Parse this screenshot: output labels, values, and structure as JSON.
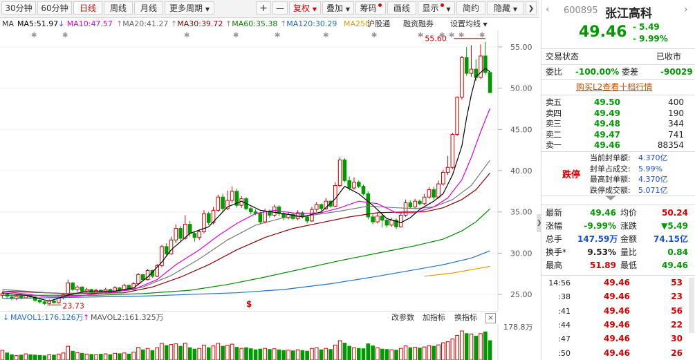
{
  "toolbar": {
    "periods": [
      "30分钟",
      "60分钟",
      "日线",
      "周线",
      "月线",
      "更多周期"
    ],
    "plus": "+",
    "minus": "—",
    "fuquan": "复权",
    "overlay": "叠加",
    "chips": "筹码",
    "draw": "画线",
    "display": "显示",
    "simple": "简约",
    "hide": "隐藏"
  },
  "ma_legend": {
    "ma": "MA",
    "ma5": "MA5:51.97",
    "ma10": "MA10:47.57",
    "ma20": "MA20:41.27",
    "ma30": "MA30:39.72",
    "ma60": "MA60:35.38",
    "ma120": "MA120:30.29",
    "ma250": "MA250",
    "hugutong": "沪股通",
    "margin": "融资融券",
    "settings": "设置均线"
  },
  "colors": {
    "ma5": "#000000",
    "ma10": "#e000e0",
    "ma20": "#777777",
    "ma30": "#8b0000",
    "ma60": "#008800",
    "ma120": "#1e6fd0",
    "ma250": "#e0a000",
    "up": "#d40000",
    "down": "#009900"
  },
  "chart_data": {
    "type": "candlestick",
    "y_ticks": [
      "55.00",
      "50.00",
      "45.00",
      "40.00",
      "35.00",
      "30.00",
      "25.00"
    ],
    "ylim": [
      23.0,
      57.0
    ],
    "high_annotation": "55.60",
    "low_annotation": "23.73",
    "candles": [
      [
        24.9,
        25.1,
        24.6,
        25.3
      ],
      [
        25.0,
        24.8,
        24.5,
        25.2
      ],
      [
        24.7,
        24.5,
        24.3,
        24.9
      ],
      [
        24.5,
        24.8,
        24.3,
        25.0
      ],
      [
        24.8,
        24.6,
        24.4,
        24.9
      ],
      [
        24.6,
        24.9,
        24.5,
        25.1
      ],
      [
        24.9,
        24.7,
        24.5,
        25.0
      ],
      [
        24.7,
        24.3,
        24.1,
        24.8
      ],
      [
        24.3,
        24.1,
        23.9,
        24.4
      ],
      [
        24.1,
        23.9,
        23.73,
        24.2
      ],
      [
        23.9,
        24.2,
        23.8,
        24.4
      ],
      [
        24.2,
        24.0,
        23.9,
        24.3
      ],
      [
        24.0,
        24.6,
        23.9,
        24.8
      ],
      [
        24.6,
        25.0,
        24.4,
        25.2
      ],
      [
        25.0,
        26.4,
        24.8,
        26.8
      ],
      [
        26.4,
        25.6,
        25.4,
        26.5
      ],
      [
        25.6,
        25.9,
        25.3,
        26.1
      ],
      [
        25.9,
        25.4,
        25.2,
        26.0
      ],
      [
        25.4,
        25.6,
        25.2,
        25.8
      ],
      [
        25.6,
        25.2,
        25.0,
        25.7
      ],
      [
        25.2,
        25.5,
        25.0,
        25.7
      ],
      [
        25.5,
        25.3,
        25.1,
        25.6
      ],
      [
        25.3,
        25.6,
        25.1,
        25.8
      ],
      [
        25.6,
        25.4,
        25.2,
        25.7
      ],
      [
        25.4,
        25.8,
        25.3,
        26.0
      ],
      [
        25.8,
        25.5,
        25.3,
        25.9
      ],
      [
        25.5,
        26.1,
        25.4,
        26.3
      ],
      [
        26.1,
        25.6,
        25.5,
        26.2
      ],
      [
        25.6,
        26.3,
        25.5,
        26.5
      ],
      [
        26.3,
        27.4,
        26.1,
        27.6
      ],
      [
        27.4,
        26.8,
        26.6,
        27.5
      ],
      [
        26.8,
        27.9,
        26.7,
        28.1
      ],
      [
        27.9,
        27.2,
        27.0,
        28.0
      ],
      [
        27.2,
        28.5,
        27.1,
        28.7
      ],
      [
        28.5,
        30.8,
        28.3,
        31.0
      ],
      [
        30.8,
        29.9,
        29.6,
        31.2
      ],
      [
        29.9,
        31.6,
        29.8,
        32.0
      ],
      [
        31.6,
        33.0,
        31.2,
        33.5
      ],
      [
        33.0,
        31.8,
        31.5,
        33.3
      ],
      [
        31.8,
        33.5,
        31.6,
        34.6
      ],
      [
        33.5,
        32.4,
        32.0,
        33.9
      ],
      [
        32.4,
        31.9,
        31.4,
        32.6
      ],
      [
        31.9,
        32.6,
        31.6,
        32.9
      ],
      [
        32.6,
        34.8,
        32.4,
        35.2
      ],
      [
        34.8,
        33.7,
        33.4,
        35.0
      ],
      [
        33.7,
        35.2,
        33.5,
        35.6
      ],
      [
        35.2,
        36.8,
        35.0,
        37.1
      ],
      [
        36.8,
        35.4,
        35.1,
        37.2
      ],
      [
        35.4,
        36.4,
        35.2,
        37.6
      ],
      [
        36.4,
        37.5,
        36.1,
        38.1
      ],
      [
        37.5,
        35.8,
        35.5,
        37.8
      ],
      [
        35.8,
        36.6,
        35.5,
        36.9
      ],
      [
        36.6,
        35.4,
        35.2,
        36.8
      ],
      [
        35.4,
        35.0,
        34.7,
        35.6
      ],
      [
        35.0,
        34.8,
        34.6,
        35.3
      ],
      [
        34.8,
        33.8,
        33.5,
        35.0
      ],
      [
        33.8,
        35.1,
        33.6,
        35.4
      ],
      [
        35.1,
        34.6,
        34.3,
        35.3
      ],
      [
        34.6,
        35.6,
        34.4,
        35.9
      ],
      [
        35.6,
        34.8,
        34.5,
        35.8
      ],
      [
        34.8,
        34.3,
        34.0,
        35.0
      ],
      [
        34.3,
        34.7,
        34.1,
        35.0
      ],
      [
        34.7,
        34.2,
        34.0,
        34.9
      ],
      [
        34.2,
        34.9,
        34.0,
        35.2
      ],
      [
        34.9,
        34.4,
        34.2,
        35.1
      ],
      [
        34.4,
        33.9,
        33.6,
        34.6
      ],
      [
        33.9,
        35.3,
        33.8,
        35.6
      ],
      [
        35.3,
        35.9,
        35.0,
        36.2
      ],
      [
        35.9,
        35.4,
        35.1,
        36.0
      ],
      [
        35.4,
        36.3,
        35.2,
        36.7
      ],
      [
        36.3,
        35.7,
        35.5,
        36.4
      ],
      [
        35.7,
        38.2,
        35.6,
        38.6
      ],
      [
        38.2,
        41.3,
        38.0,
        41.6
      ],
      [
        41.3,
        38.8,
        38.6,
        41.5
      ],
      [
        38.8,
        37.9,
        37.6,
        39.3
      ],
      [
        37.9,
        38.6,
        37.7,
        39.2
      ],
      [
        38.6,
        38.1,
        37.9,
        38.8
      ],
      [
        38.1,
        37.2,
        37.0,
        38.3
      ],
      [
        37.2,
        34.4,
        34.1,
        37.5
      ],
      [
        34.4,
        33.8,
        33.5,
        34.8
      ],
      [
        33.8,
        34.5,
        33.6,
        34.9
      ],
      [
        34.5,
        34.0,
        33.1,
        34.7
      ],
      [
        34.0,
        33.4,
        33.1,
        34.2
      ],
      [
        33.4,
        34.0,
        33.2,
        34.3
      ],
      [
        34.0,
        33.2,
        32.9,
        34.2
      ],
      [
        33.2,
        34.6,
        33.1,
        35.0
      ],
      [
        34.6,
        36.1,
        34.4,
        36.5
      ],
      [
        36.1,
        35.6,
        35.4,
        36.4
      ],
      [
        35.6,
        36.3,
        35.4,
        36.6
      ],
      [
        36.3,
        36.0,
        35.8,
        36.5
      ],
      [
        36.0,
        36.8,
        35.8,
        37.2
      ],
      [
        36.8,
        37.7,
        36.6,
        38.0
      ],
      [
        37.7,
        36.8,
        36.5,
        38.1
      ],
      [
        36.8,
        38.4,
        36.6,
        38.8
      ],
      [
        38.4,
        39.8,
        38.2,
        40.1
      ],
      [
        39.8,
        40.4,
        39.5,
        41.8
      ],
      [
        40.4,
        44.4,
        40.2,
        44.6
      ],
      [
        44.4,
        48.9,
        44.2,
        49.0
      ],
      [
        48.9,
        53.7,
        48.6,
        53.9
      ],
      [
        53.7,
        51.8,
        51.5,
        55.0
      ],
      [
        51.8,
        52.3,
        51.4,
        55.2
      ],
      [
        52.3,
        51.3,
        50.9,
        53.5
      ],
      [
        51.3,
        53.9,
        51.1,
        55.3
      ],
      [
        53.9,
        51.9,
        51.6,
        55.6
      ],
      [
        51.9,
        49.46,
        49.46,
        51.89
      ]
    ],
    "ma5": [
      [
        0,
        25.2
      ],
      [
        5,
        24.9
      ],
      [
        10,
        24.2
      ],
      [
        14,
        24.9
      ],
      [
        18,
        25.4
      ],
      [
        24,
        25.4
      ],
      [
        28,
        25.8
      ],
      [
        31,
        27.1
      ],
      [
        34,
        28.9
      ],
      [
        36,
        30.4
      ],
      [
        40,
        32.4
      ],
      [
        44,
        33.2
      ],
      [
        48,
        35.6
      ],
      [
        51,
        36.3
      ],
      [
        55,
        35.2
      ],
      [
        60,
        34.8
      ],
      [
        64,
        34.4
      ],
      [
        68,
        35.0
      ],
      [
        71,
        36.6
      ],
      [
        73,
        38.1
      ],
      [
        76,
        37.2
      ],
      [
        79,
        35.8
      ],
      [
        82,
        34.2
      ],
      [
        85,
        33.7
      ],
      [
        87,
        34.3
      ],
      [
        89,
        35.3
      ],
      [
        92,
        36.3
      ],
      [
        94,
        37.2
      ],
      [
        96,
        39.5
      ],
      [
        98,
        43.0
      ],
      [
        99,
        46.4
      ],
      [
        100,
        49.2
      ],
      [
        101,
        51.4
      ],
      [
        103,
        52.4
      ],
      [
        104,
        51.97
      ]
    ],
    "ma10": [
      [
        0,
        25.4
      ],
      [
        10,
        24.7
      ],
      [
        16,
        24.8
      ],
      [
        22,
        25.2
      ],
      [
        28,
        25.6
      ],
      [
        33,
        26.8
      ],
      [
        37,
        28.6
      ],
      [
        42,
        30.4
      ],
      [
        46,
        32.1
      ],
      [
        50,
        33.6
      ],
      [
        54,
        34.8
      ],
      [
        58,
        35.2
      ],
      [
        63,
        34.8
      ],
      [
        68,
        34.9
      ],
      [
        72,
        35.5
      ],
      [
        76,
        36.3
      ],
      [
        80,
        36.0
      ],
      [
        84,
        34.9
      ],
      [
        88,
        34.9
      ],
      [
        92,
        35.6
      ],
      [
        95,
        36.7
      ],
      [
        98,
        38.9
      ],
      [
        100,
        41.6
      ],
      [
        102,
        44.7
      ],
      [
        104,
        47.57
      ]
    ],
    "ma20": [
      [
        0,
        25.6
      ],
      [
        12,
        25.1
      ],
      [
        24,
        25.3
      ],
      [
        30,
        25.9
      ],
      [
        36,
        27.3
      ],
      [
        42,
        29.3
      ],
      [
        48,
        31.6
      ],
      [
        54,
        33.4
      ],
      [
        60,
        34.3
      ],
      [
        66,
        34.6
      ],
      [
        72,
        35.1
      ],
      [
        78,
        35.7
      ],
      [
        84,
        35.5
      ],
      [
        88,
        35.4
      ],
      [
        92,
        35.6
      ],
      [
        96,
        36.5
      ],
      [
        100,
        38.2
      ],
      [
        104,
        41.27
      ]
    ],
    "ma30": [
      [
        0,
        25.4
      ],
      [
        14,
        25.1
      ],
      [
        26,
        25.2
      ],
      [
        32,
        25.9
      ],
      [
        38,
        27.1
      ],
      [
        44,
        28.6
      ],
      [
        50,
        30.4
      ],
      [
        56,
        31.9
      ],
      [
        62,
        33.0
      ],
      [
        68,
        33.7
      ],
      [
        74,
        34.4
      ],
      [
        80,
        34.9
      ],
      [
        86,
        35.0
      ],
      [
        90,
        35.0
      ],
      [
        94,
        35.5
      ],
      [
        98,
        36.5
      ],
      [
        101,
        37.7
      ],
      [
        104,
        39.72
      ]
    ],
    "ma60": [
      [
        0,
        24.9
      ],
      [
        20,
        24.9
      ],
      [
        30,
        25.1
      ],
      [
        40,
        25.5
      ],
      [
        48,
        26.2
      ],
      [
        56,
        27.1
      ],
      [
        64,
        28.1
      ],
      [
        72,
        29.1
      ],
      [
        80,
        30.0
      ],
      [
        88,
        30.9
      ],
      [
        94,
        31.7
      ],
      [
        98,
        32.7
      ],
      [
        101,
        33.8
      ],
      [
        104,
        35.38
      ]
    ],
    "ma120": [
      [
        0,
        24.5
      ],
      [
        30,
        24.8
      ],
      [
        50,
        25.2
      ],
      [
        60,
        25.6
      ],
      [
        70,
        26.3
      ],
      [
        80,
        27.2
      ],
      [
        88,
        28.0
      ],
      [
        94,
        28.6
      ],
      [
        100,
        29.4
      ],
      [
        104,
        30.29
      ]
    ],
    "ma250": [
      [
        90,
        27.2
      ],
      [
        96,
        27.6
      ],
      [
        100,
        28.0
      ],
      [
        104,
        28.4
      ]
    ],
    "volume": [
      55,
      40,
      30,
      25,
      28,
      35,
      30,
      28,
      26,
      24,
      30,
      28,
      34,
      40,
      78,
      50,
      42,
      38,
      34,
      32,
      30,
      33,
      35,
      30,
      38,
      36,
      40,
      34,
      45,
      72,
      58,
      66,
      54,
      70,
      95,
      82,
      88,
      92,
      78,
      96,
      70,
      62,
      66,
      85,
      70,
      80,
      95,
      78,
      84,
      90,
      72,
      66,
      70,
      64,
      58,
      62,
      66,
      60,
      64,
      58,
      54,
      56,
      52,
      58,
      54,
      50,
      66,
      70,
      58,
      66,
      60,
      85,
      110,
      96,
      78,
      70,
      66,
      64,
      92,
      80,
      70,
      62,
      60,
      58,
      56,
      66,
      80,
      70,
      72,
      68,
      74,
      82,
      78,
      86,
      98,
      104,
      120,
      140,
      165,
      150,
      148,
      136,
      150,
      160,
      110
    ],
    "vol_ymax": "178.8万",
    "vol_ma1": "MAVOL1:176.126万",
    "vol_ma2": "MAVOL2:161.325万"
  },
  "vol_tools": {
    "params": "改参数",
    "add_indicator": "加指标",
    "switch_indicator": "换指标",
    "close": "×"
  },
  "stock": {
    "code": "600895",
    "name": "张江高科",
    "price": "49.46",
    "change": "- 5.49",
    "change_pct": "- 9.99%",
    "trade_state_label": "交易状态",
    "trade_state": "已收市",
    "weibi_label": "委比",
    "weibi": "-100.00%",
    "weicha_label": "委差",
    "weicha": "-90029",
    "l2_link": "购买L2查看十档行情",
    "sells": [
      {
        "label": "卖五",
        "price": "49.50",
        "vol": "400"
      },
      {
        "label": "卖四",
        "price": "49.49",
        "vol": "190"
      },
      {
        "label": "卖三",
        "price": "49.48",
        "vol": "344"
      },
      {
        "label": "卖二",
        "price": "49.47",
        "vol": "741"
      },
      {
        "label": "卖一",
        "price": "49.46",
        "vol": "88354"
      }
    ],
    "limit_label": "跌停",
    "limit_rows": [
      {
        "label": "当前封单额:",
        "value": "4.370亿"
      },
      {
        "label": "封单占成交:",
        "value": "5.99%"
      },
      {
        "label": "最高封单额:",
        "value": "4.370亿"
      },
      {
        "label": "跌停成交额:",
        "value": "5.071亿"
      }
    ],
    "stats": [
      {
        "l1": "最新",
        "v1": "49.46",
        "l2": "均价",
        "v2": "50.24"
      },
      {
        "l1": "涨幅",
        "v1": "-9.99%",
        "l2": "涨跌",
        "v2": "▼5.49"
      },
      {
        "l1": "总手",
        "v1": "147.59万",
        "l2": "金额",
        "v2": "74.15亿"
      },
      {
        "l1": "换手*",
        "v1": "9.53%",
        "l2": "量比",
        "v2": "0.84"
      },
      {
        "l1": "最高",
        "v1": "51.89",
        "l2": "最低",
        "v2": "49.46"
      }
    ],
    "ticks": [
      {
        "time": "14:56",
        "price": "49.46",
        "vol": "53"
      },
      {
        "time": ":38",
        "price": "49.46",
        "vol": "23"
      },
      {
        "time": ":41",
        "price": "49.46",
        "vol": "56"
      },
      {
        "time": ":44",
        "price": "49.46",
        "vol": "22"
      },
      {
        "time": ":47",
        "price": "49.46",
        "vol": "30"
      },
      {
        "time": ":50",
        "price": "49.46",
        "vol": "26"
      }
    ]
  }
}
